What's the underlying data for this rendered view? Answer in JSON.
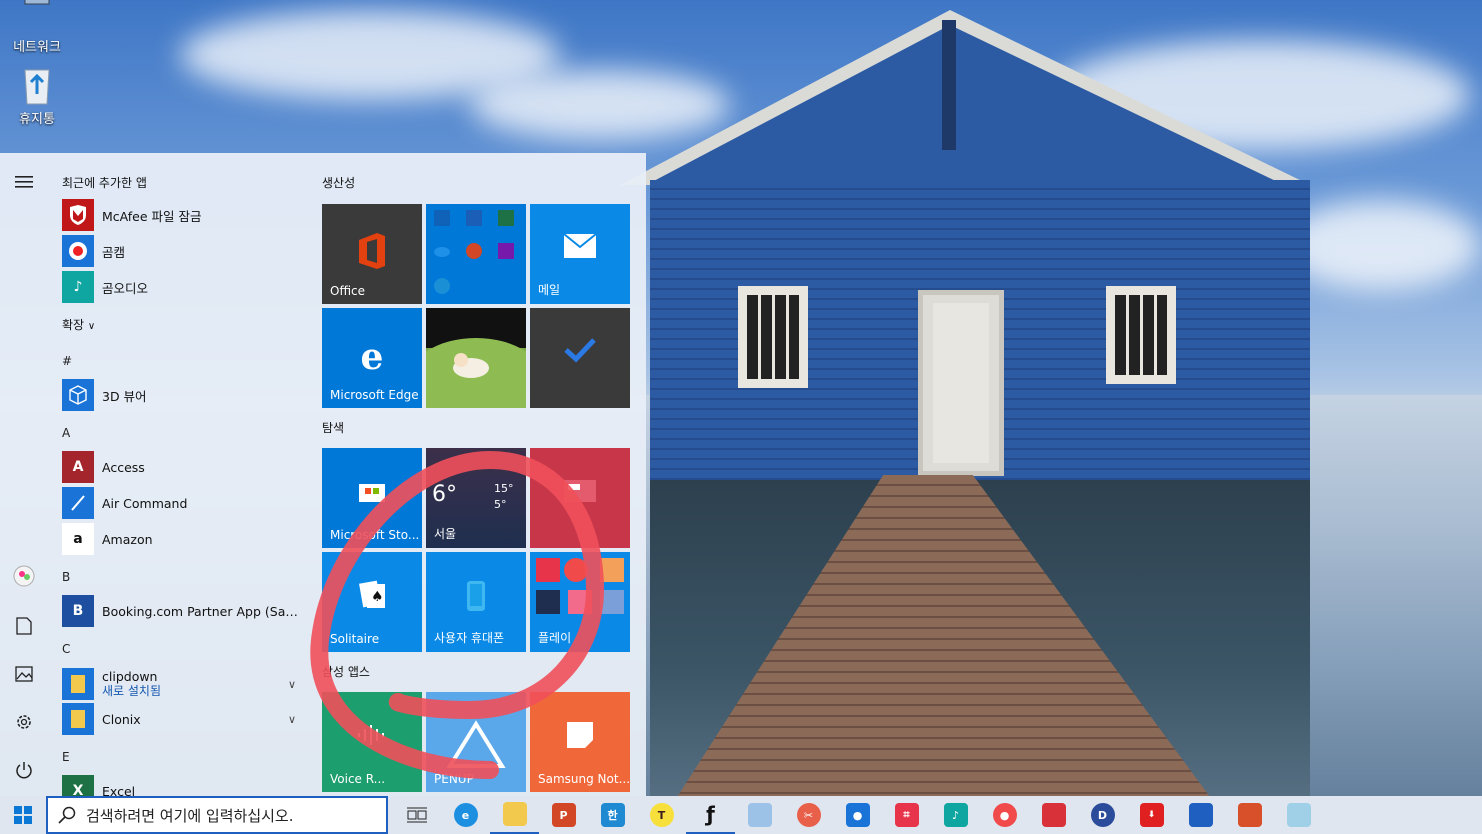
{
  "desktop": {
    "icons": [
      {
        "label": "네트워크"
      },
      {
        "label": "휴지통"
      }
    ]
  },
  "start_menu": {
    "recent_header": "최근에 추가한 앱",
    "recent_apps": [
      {
        "label": "McAfee 파일 잠금",
        "color": "#c01818"
      },
      {
        "label": "곰캠",
        "color": "#1a74d8"
      },
      {
        "label": "곰오디오",
        "color": "#0fa5a0"
      }
    ],
    "expand_label": "확장",
    "sections": [
      {
        "letter": "#",
        "apps": [
          {
            "label": "3D 뷰어",
            "color": "#1a74d8"
          }
        ]
      },
      {
        "letter": "A",
        "apps": [
          {
            "label": "Access",
            "color": "#a4262c"
          },
          {
            "label": "Air Command",
            "color": "#1a74d8"
          },
          {
            "label": "Amazon",
            "color": "#ffffff"
          }
        ]
      },
      {
        "letter": "B",
        "apps": [
          {
            "label": "Booking.com Partner App (Samsun...",
            "color": "#1d4ea0"
          }
        ]
      },
      {
        "letter": "C",
        "apps": [
          {
            "label": "clipdown",
            "sub": "새로 설치됨",
            "color": "#f2c94c"
          },
          {
            "label": "Clonix",
            "color": "#f2c94c"
          }
        ]
      },
      {
        "letter": "E",
        "apps": [
          {
            "label": "Excel",
            "color": "#1e7145"
          }
        ]
      }
    ],
    "groups": [
      {
        "title": "생산성"
      },
      {
        "title": "탐색"
      },
      {
        "title": "삼성 앱스"
      }
    ],
    "tiles": {
      "office": "Office",
      "mail": "메일",
      "edge": "Microsoft Edge",
      "store": "Microsoft Sto...",
      "weather_temp": "6°",
      "weather_high": "15°",
      "weather_low": "5°",
      "weather_city": "서울",
      "solitaire": "Solitaire",
      "your_phone": "사용자 휴대폰",
      "play": "플레이",
      "voice": "Voice R...",
      "penup": "PENUP",
      "samsung_notes": "Samsung Not..."
    }
  },
  "taskbar": {
    "search_placeholder": "검색하려면 여기에 입력하십시오."
  },
  "colors": {
    "tile_blue": "#0078d7",
    "tile_dark": "#3a3a3a",
    "annotation": "#f0505a"
  }
}
